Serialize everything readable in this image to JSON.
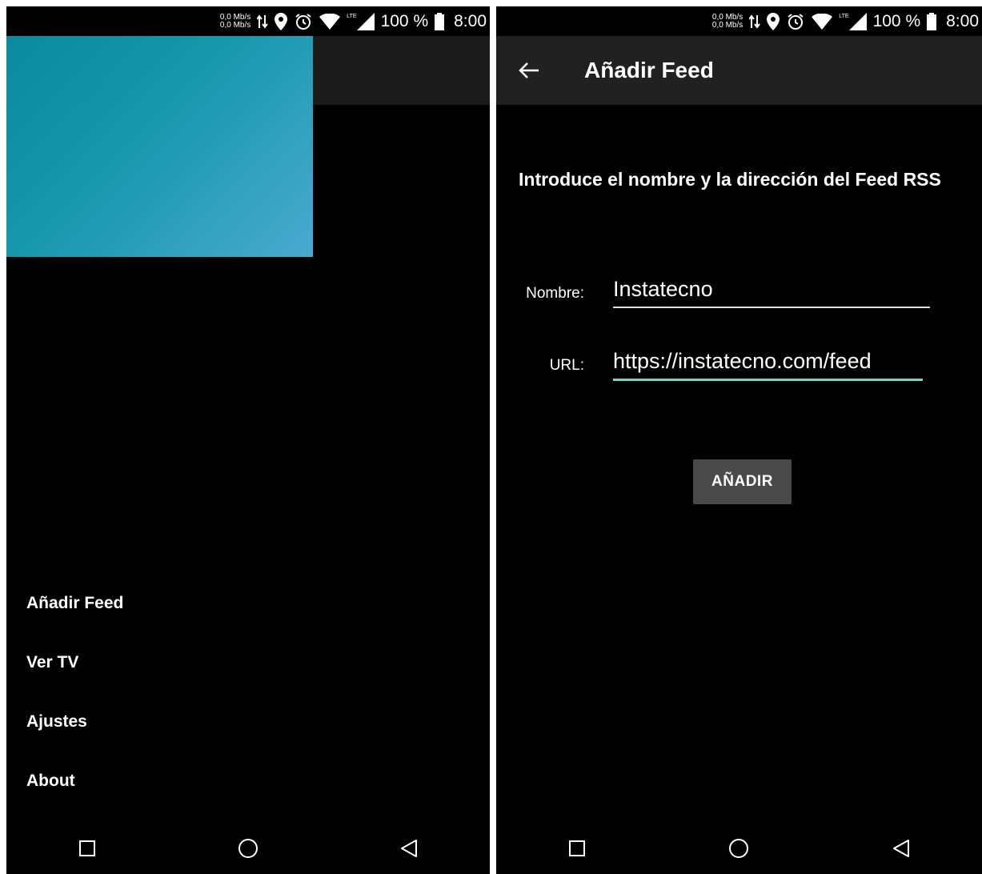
{
  "status_bar": {
    "net_up": "0,0 Mb/s",
    "net_down": "0,0 Mb/s",
    "network_type": "LTE",
    "battery": "100 %",
    "time": "8:00",
    "icons": [
      "data-arrows-icon",
      "location-icon",
      "alarm-icon",
      "wifi-icon",
      "signal-icon",
      "battery-icon"
    ]
  },
  "drawer": {
    "menu": [
      {
        "label": "Añadir Feed"
      },
      {
        "label": "Ver TV"
      },
      {
        "label": "Ajustes"
      },
      {
        "label": "About"
      }
    ],
    "header_colors": [
      "#0a8a9c",
      "#4aaad0"
    ]
  },
  "add_feed": {
    "title": "Añadir Feed",
    "instructions": "Introduce el nombre y la dirección del Feed RSS",
    "name_label": "Nombre:",
    "name_value": "Instatecno",
    "url_label": "URL:",
    "url_value": "https://instatecno.com/feed",
    "add_button": "AÑADIR",
    "accent_color": "#7fd1c2"
  },
  "nav_bar": {
    "icons": [
      "recents-icon",
      "home-icon",
      "back-nav-icon"
    ]
  }
}
